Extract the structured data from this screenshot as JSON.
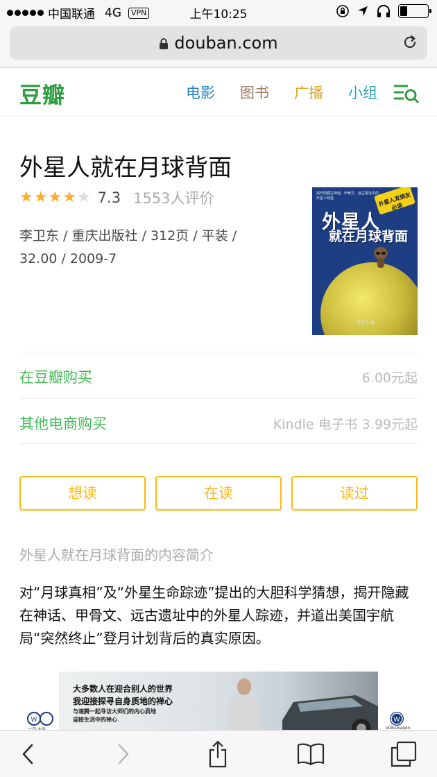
{
  "status_bar": {
    "carrier": "中国联通",
    "network": "4G",
    "vpn": "VPN",
    "time": "上午10:25",
    "battery_level": 0.25
  },
  "browser": {
    "url": "douban.com"
  },
  "site": {
    "logo": "豆瓣",
    "nav": {
      "movie": "电影",
      "book": "图书",
      "broadcast": "广播",
      "group": "小组"
    },
    "colors": {
      "brand_green": "#2f9d3f",
      "link_green": "#42bd56",
      "star_orange": "#ffac2d",
      "button_yellow": "#ffb712"
    }
  },
  "book": {
    "title": "外星人就在月球背面",
    "stars": 3.5,
    "rating": "7.3",
    "rating_count": "1553人评价",
    "meta_line1": "李卫东 / 重庆出版社 / 312页 / 平装 /",
    "meta_line2": "32.00 / 2009-7",
    "cover": {
      "title_line1": "外星人",
      "title_line2": "就在月球背面",
      "badge": "外星人发烧友必读",
      "tagline": "揭开隐藏在神话、甲骨文、远古遗址中的外星人踪迹",
      "author": "李卫东 著"
    }
  },
  "buy": [
    {
      "label": "在豆瓣购买",
      "price": "6.00元起"
    },
    {
      "label": "其他电商购买",
      "price": "Kindle 电子书 3.99元起"
    }
  ],
  "buttons": {
    "want": "想读",
    "reading": "在读",
    "read": "读过"
  },
  "intro": {
    "heading": "外星人就在月球背面的内容简介",
    "body": "对“月球真相”及“外星生命踪迹”提出的大胆科学猜想，揭开隐藏在神话、甲骨文、远古遗址中的外星人踪迹，并道出美国宇航局“突然终止”登月计划背后的真实原因。"
  },
  "ad": {
    "line1": "大多数人在迎合别人的世界",
    "line2": "我迎接探寻自身质地的禅心",
    "line3": "与速腾一起寻访大师们的内心质地",
    "line4": "迎接生活中的禅心",
    "brand_left": "一汽-大众",
    "brand_right": "Volkswagen"
  }
}
